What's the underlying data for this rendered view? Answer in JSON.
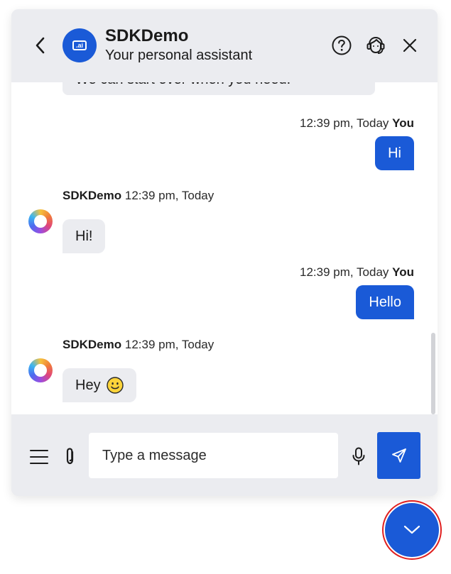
{
  "header": {
    "title": "SDKDemo",
    "subtitle": "Your personal assistant",
    "avatar_badge": ".ai",
    "icons": [
      "back-arrow-icon",
      "help-icon",
      "agent-icon",
      "close-icon"
    ]
  },
  "messages": {
    "partial_text": "We can start over when you need.",
    "items": [
      {
        "from": "user",
        "time": "12:39 pm, Today",
        "sender": "You",
        "text": "Hi"
      },
      {
        "from": "bot",
        "sender": "SDKDemo",
        "time": "12:39 pm, Today",
        "text": "Hi!"
      },
      {
        "from": "user",
        "time": "12:39 pm, Today",
        "sender": "You",
        "text": "Hello"
      },
      {
        "from": "bot",
        "sender": "SDKDemo",
        "time": "12:39 pm, Today",
        "text": "Hey",
        "emoji": "slightly-smiling-face"
      }
    ]
  },
  "composer": {
    "placeholder": "Type a message",
    "icons": [
      "menu-icon",
      "paperclip-icon",
      "microphone-icon",
      "send-icon"
    ]
  },
  "colors": {
    "accent": "#1a5ad7",
    "panel": "#ebecf0",
    "highlight_ring": "#e02020"
  }
}
